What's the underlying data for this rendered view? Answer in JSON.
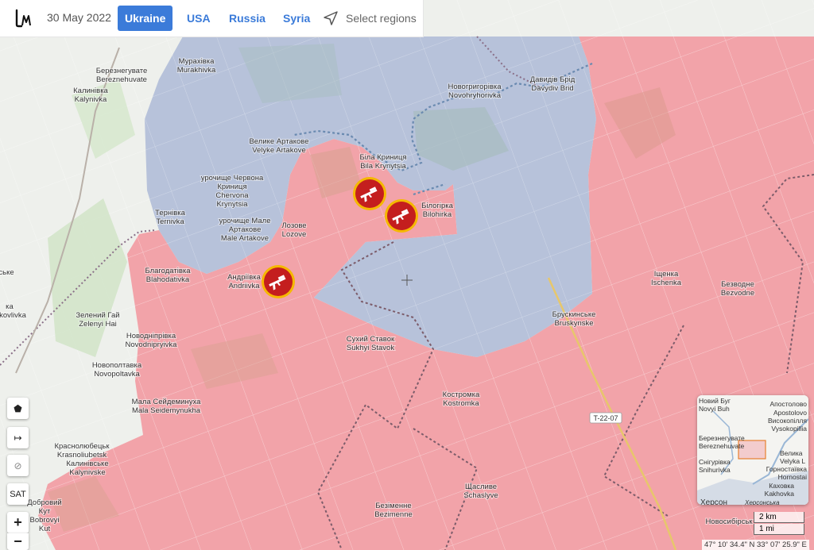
{
  "header": {
    "date": "30 May 2022",
    "tabs": [
      {
        "label": "Ukraine",
        "active": true
      },
      {
        "label": "USA",
        "active": false
      },
      {
        "label": "Russia",
        "active": false
      },
      {
        "label": "Syria",
        "active": false
      }
    ],
    "select_regions_label": "Select regions",
    "select_regions_icon": "navigation-arrow-icon",
    "logo_icon": "liveuamap-logo-icon"
  },
  "colors": {
    "occupied_red": "#f2a3a9",
    "contested_blue": "#b7c2da",
    "active_tab": "#3b7bd9",
    "event_icon": "#c41e1e",
    "event_ring": "#f5b800"
  },
  "map": {
    "places": [
      {
        "ua": "Мурахівка",
        "en": "Murakhivka"
      },
      {
        "ua": "Березнегувате",
        "en": "Bereznehuvate"
      },
      {
        "ua": "Калинівка",
        "en": "Kalynivka"
      },
      {
        "ua": "Новогригорівка",
        "en": "Novohryhorivka"
      },
      {
        "ua": "Давидів Брід",
        "en": "Davydiv Brid"
      },
      {
        "ua": "Велике Артакове",
        "en": "Velyke Artakove"
      },
      {
        "ua": "Біла Криниця",
        "en": "Bila Krynytsia"
      },
      {
        "ua": "Білогірка",
        "en": "Bilohirka"
      },
      {
        "ua": "урочище Червона Криниця",
        "en": "Chervona Krynytsia"
      },
      {
        "ua": "Тернівка",
        "en": "Ternivka"
      },
      {
        "ua": "урочище Мале Артакове",
        "en": "Male Artakove"
      },
      {
        "ua": "Лозове",
        "en": "Lozove"
      },
      {
        "ua": "Благодатівка",
        "en": "Blahodativka"
      },
      {
        "ua": "Андріївка",
        "en": "Andriivka"
      },
      {
        "ua": "Зелений Гай",
        "en": "Zelenyi Hai"
      },
      {
        "ua": "Новодніпрівка",
        "en": "Novodnipryivka"
      },
      {
        "ua": "Новополтавка",
        "en": "Novopoltavka"
      },
      {
        "ua": "Сухий Ставок",
        "en": "Sukhyi Stavok"
      },
      {
        "ua": "Брускинське",
        "en": "Bruskynske"
      },
      {
        "ua": "Іщенка",
        "en": "Ischenka"
      },
      {
        "ua": "Безводне",
        "en": "Bezvodne"
      },
      {
        "ua": "Костромка",
        "en": "Kostromka"
      },
      {
        "ua": "Мала Сейдеминуха",
        "en": "Mala Seidemynukha"
      },
      {
        "ua": "Краснолюбецьк",
        "en": "Krasnoliubetsk"
      },
      {
        "ua": "Калинівське",
        "en": "Kalynivske"
      },
      {
        "ua": "Щасливе",
        "en": "Schaslyve"
      },
      {
        "ua": "Безіменне",
        "en": "Bezimenne"
      },
      {
        "ua": "Добровий Кут",
        "en": "Bobrovyi Kut"
      },
      {
        "ua": "Новосибірськ",
        "en": ""
      }
    ],
    "edge_labels": {
      "left1": "ське",
      "left2": "ка",
      "left3": "kovlivka"
    },
    "road_label": "T-22-07",
    "event_icon": "rifle-icon"
  },
  "controls": [
    {
      "name": "draw-polygon-button",
      "icon": "polygon-icon",
      "label": "⬟"
    },
    {
      "name": "measure-button",
      "icon": "measure-arrow-icon",
      "label": "↦"
    },
    {
      "name": "hide-layers-button",
      "icon": "eye-slash-icon",
      "label": "⊘"
    },
    {
      "name": "satellite-button",
      "icon": "",
      "label": "SAT"
    },
    {
      "name": "zoom-in-button",
      "icon": "plus-icon",
      "label": "+"
    },
    {
      "name": "zoom-out-button",
      "icon": "minus-icon",
      "label": "−"
    }
  ],
  "minimap": {
    "places": [
      "Новий Буг",
      "Novyi Buh",
      "Апостолово",
      "Apostolovo",
      "Високопілля",
      "Vysokopillia",
      "Березнегувате",
      "Bereznehuvate",
      "Велика",
      "Velyka L",
      "Снігурівка",
      "Snihurivka",
      "Горностаївка",
      "Hornostai",
      "Каховка",
      "Kakhovka",
      "Херсон",
      "Херсонська"
    ]
  },
  "scale": {
    "km": "2 km",
    "mi": "1 mi"
  },
  "coordinates": "47° 10' 34.4\" N 33° 07' 25.9\" E"
}
